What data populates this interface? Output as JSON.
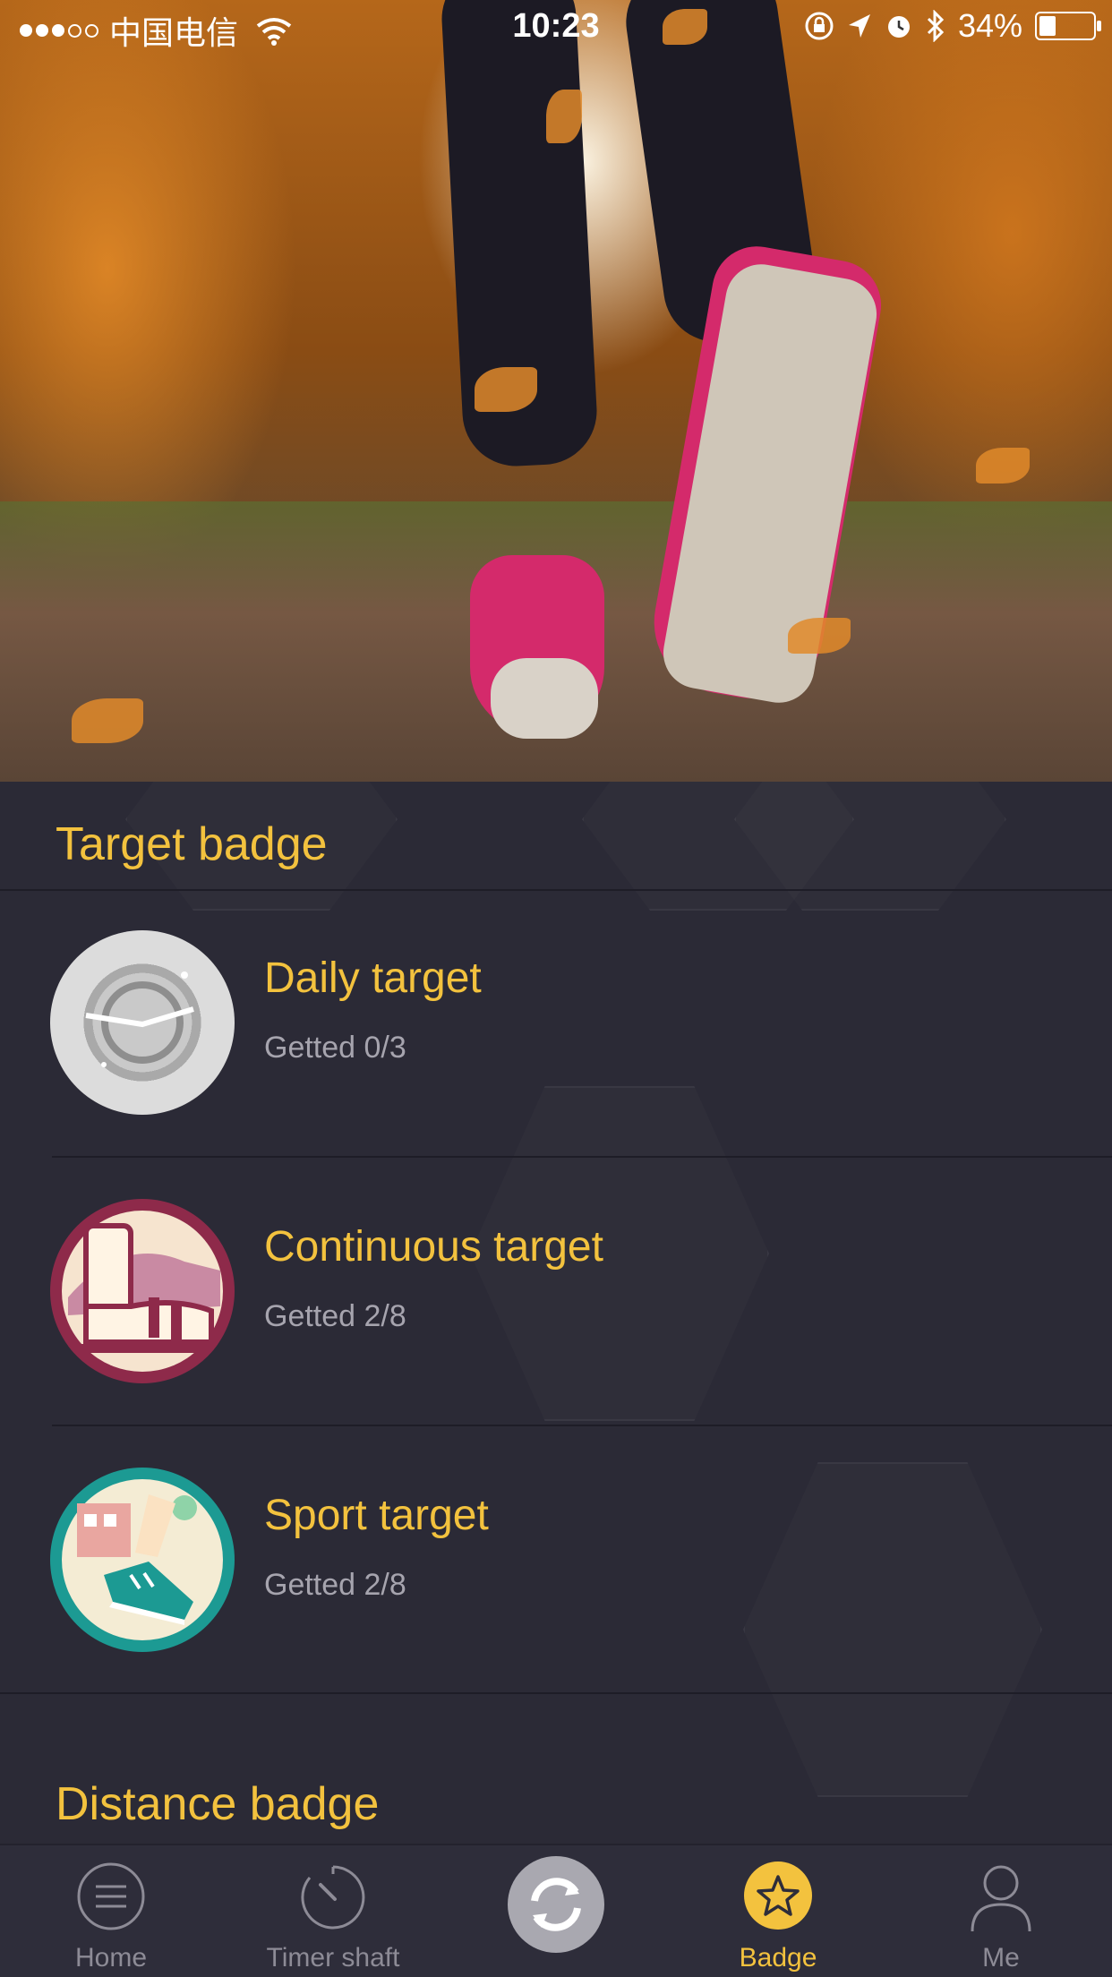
{
  "status_bar": {
    "carrier": "中国电信",
    "time": "10:23",
    "battery": "34%",
    "battery_level": 0.34
  },
  "target_section": {
    "title": "Target badge",
    "items": [
      {
        "title": "Daily target",
        "progress": "Getted 0/3",
        "icon": "clock-badge-icon"
      },
      {
        "title": "Continuous target",
        "progress": "Getted 2/8",
        "icon": "foot-steps-badge-icon"
      },
      {
        "title": "Sport target",
        "progress": "Getted 2/8",
        "icon": "running-shoe-badge-icon"
      }
    ]
  },
  "distance_section": {
    "title": "Distance badge"
  },
  "tab_bar": {
    "tabs": [
      {
        "label": "Home",
        "icon": "menu-icon"
      },
      {
        "label": "Timer shaft",
        "icon": "timer-icon"
      },
      {
        "label": "",
        "icon": "sync-icon"
      },
      {
        "label": "Badge",
        "icon": "star-icon",
        "active": true
      },
      {
        "label": "Me",
        "icon": "person-icon"
      }
    ]
  },
  "colors": {
    "accent": "#f3c23e",
    "background": "#2b2a36",
    "subtext": "#a6a4ae"
  }
}
